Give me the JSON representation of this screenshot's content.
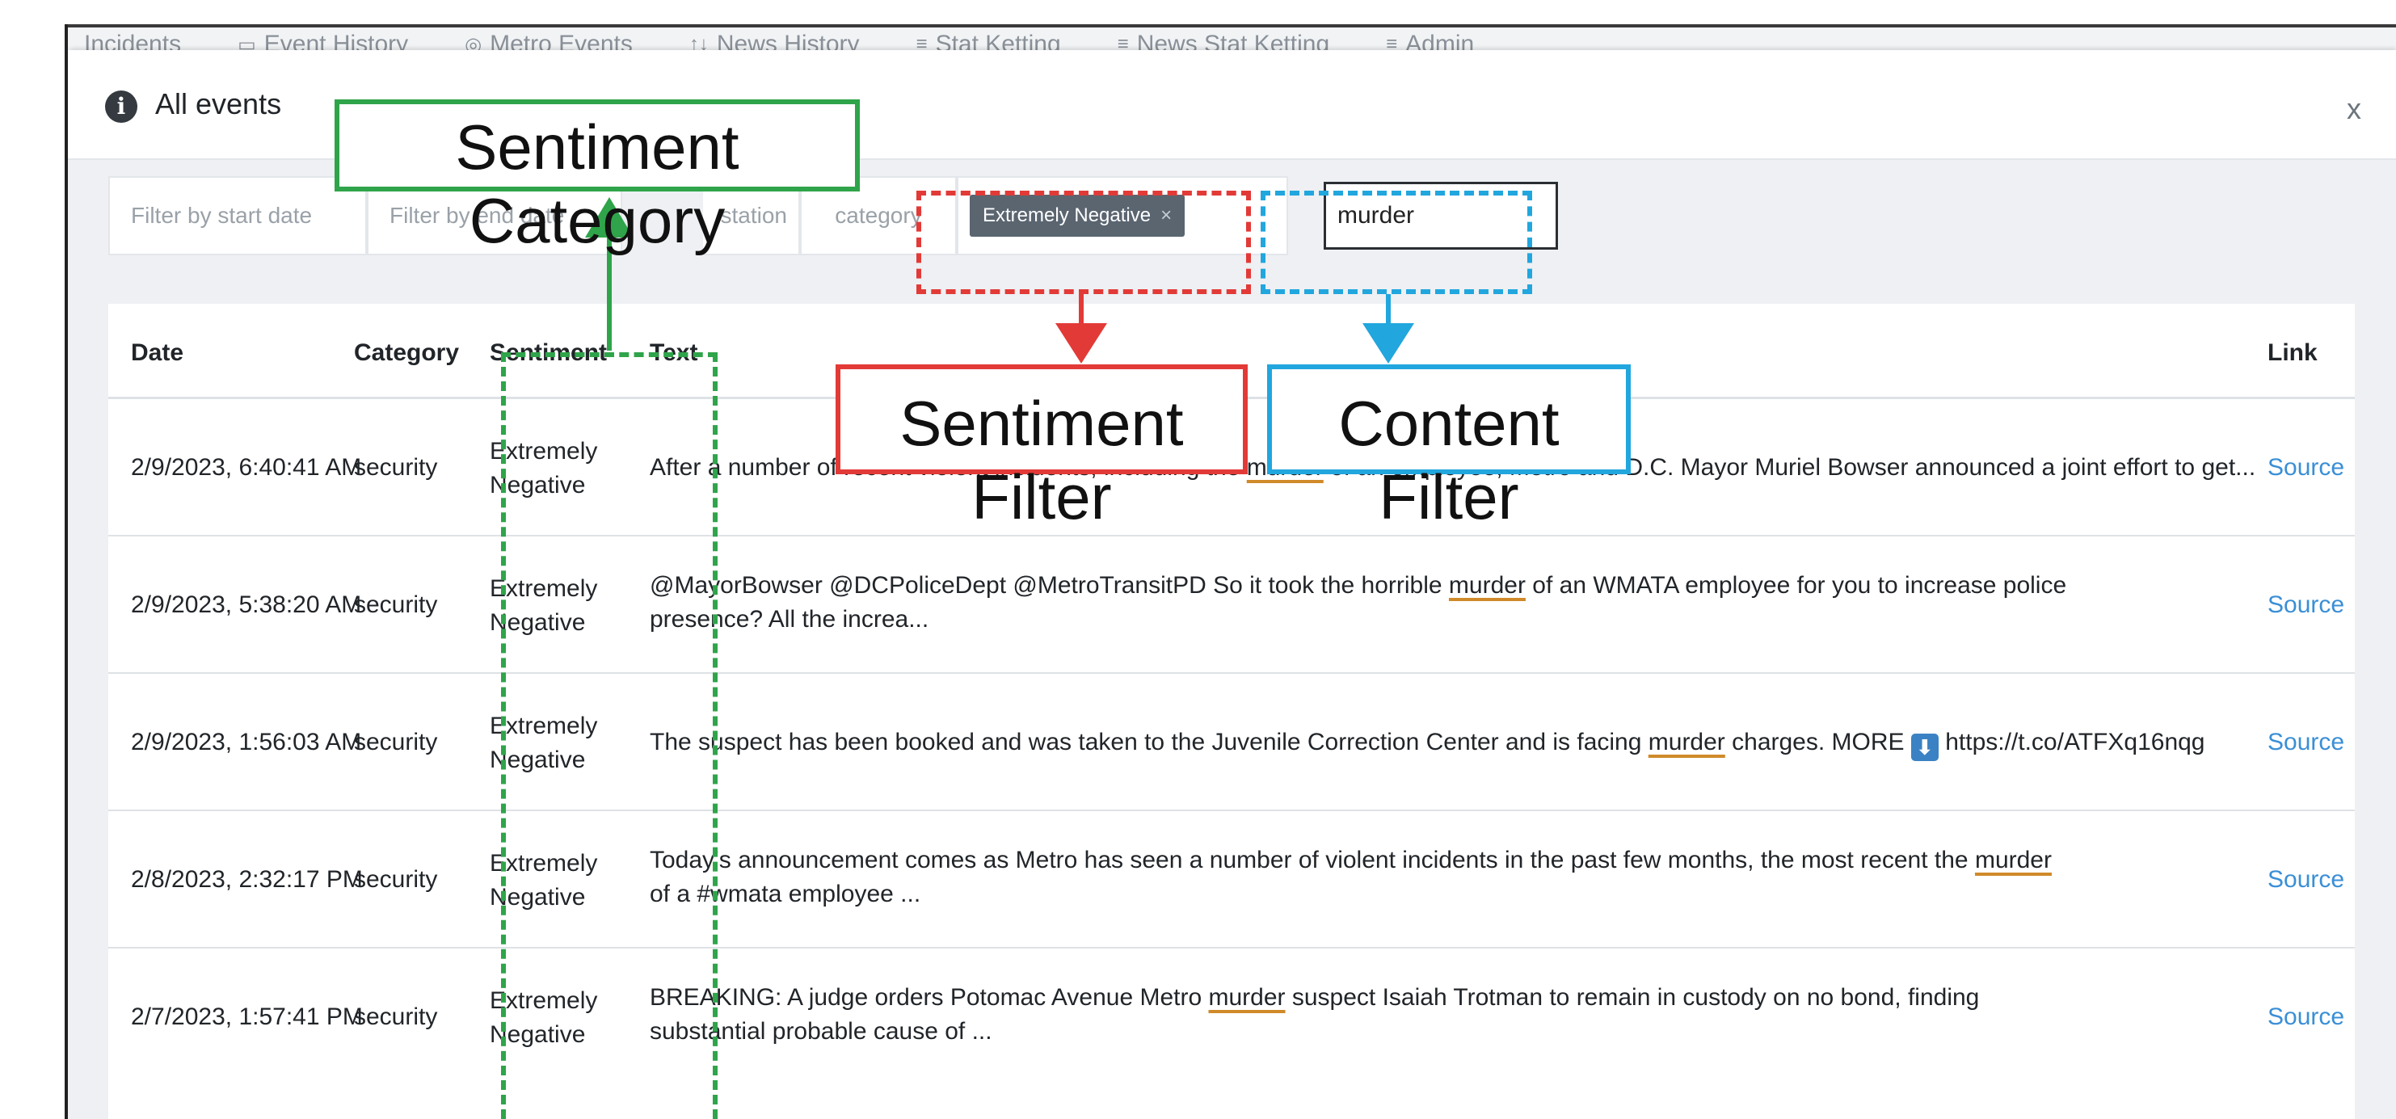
{
  "background_nav": {
    "items": [
      "Incidents",
      "Event History",
      "Metro Events",
      "News History",
      "Stat Ketting",
      "News Stat Ketting",
      "Admin"
    ]
  },
  "modal": {
    "title": "All events",
    "close_label": "x"
  },
  "filters": {
    "start_date_placeholder": "Filter by start date",
    "end_date_placeholder": "Filter by end date",
    "station_placeholder": "station",
    "category_placeholder": "category",
    "sentiment_tag": "Extremely Negative",
    "sentiment_tag_remove": "×",
    "content_value": "murder"
  },
  "table": {
    "headers": {
      "date": "Date",
      "category": "Category",
      "sentiment": "Sentiment",
      "text": "Text",
      "link": "Link"
    },
    "rows": [
      {
        "date": "2/9/2023, 6:40:41 AM",
        "category": "security",
        "sentiment": "Extremely Negative",
        "text_before": "After a number of recent violent incidents, including the ",
        "keyword": "murder",
        "text_after": " of an employee, Metro and D.C. Mayor Muriel Bowser announced a joint effort to get...",
        "link": "Source"
      },
      {
        "date": "2/9/2023, 5:38:20 AM",
        "category": "security",
        "sentiment": "Extremely Negative",
        "text_before": "@MayorBowser @DCPoliceDept @MetroTransitPD So it took the horrible ",
        "keyword": "murder",
        "text_after": " of an WMATA employee for you to increase police presence? All the increa...",
        "link": "Source"
      },
      {
        "date": "2/9/2023, 1:56:03 AM",
        "category": "security",
        "sentiment": "Extremely Negative",
        "text_before": "The suspect has been booked and was taken to the Juvenile Correction Center and is facing ",
        "keyword": "murder",
        "text_after": " charges. MORE ",
        "emoji": "⬇",
        "text_tail": " https://t.co/ATFXq16nqg",
        "link": "Source"
      },
      {
        "date": "2/8/2023, 2:32:17 PM",
        "category": "security",
        "sentiment": "Extremely Negative",
        "text_before": "Today's announcement comes as Metro has seen a number of violent incidents in the past few months, the most recent the ",
        "keyword": "murder",
        "text_after": " of a #wmata employee ...",
        "link": "Source"
      },
      {
        "date": "2/7/2023, 1:57:41 PM",
        "category": "security",
        "sentiment": "Extremely Negative",
        "text_before": "BREAKING: A judge orders Potomac Avenue Metro ",
        "keyword": "murder",
        "text_after": " suspect Isaiah Trotman to remain in custody on no bond, finding substantial probable cause of ...",
        "link": "Source"
      }
    ]
  },
  "annotations": {
    "sentiment_category": "Sentiment Category",
    "sentiment_filter": "Sentiment Filter",
    "content_filter": "Content Filter",
    "colors": {
      "green": "#2fa44a",
      "red": "#e23a37",
      "blue": "#21a6de"
    }
  }
}
